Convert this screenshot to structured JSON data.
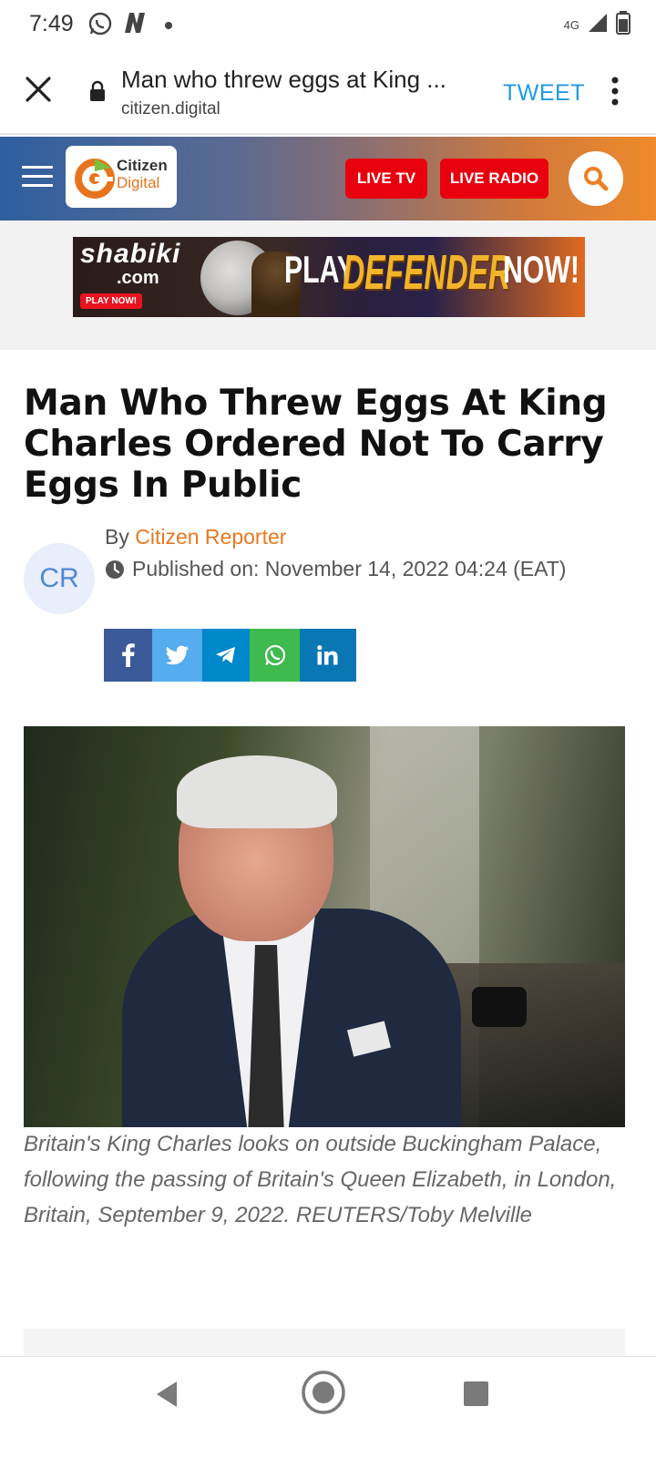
{
  "status_bar": {
    "time": "7:49",
    "network": "4G",
    "icons": [
      "whatsapp-icon",
      "n-app-icon",
      "dot-icon",
      "signal-icon",
      "battery-icon"
    ]
  },
  "browser": {
    "page_title": "Man who threw eggs at King ...",
    "domain": "citizen.digital",
    "action_label": "TWEET",
    "accent_color": "#1e9be0"
  },
  "site_header": {
    "logo_line1": "Citizen",
    "logo_line2": "Digital",
    "live_tv_label": "LIVE TV",
    "live_radio_label": "LIVE RADIO",
    "live_color": "#e8000f",
    "brand_color": "#f08a2a"
  },
  "ad": {
    "brand": "shabiki",
    "brand_suffix": ".com",
    "cta_small": "PLAY NOW!",
    "headline_play": "PLAY",
    "headline_game": "DEFENDER",
    "headline_now": "NOW!"
  },
  "article": {
    "title": "Man Who Threw Eggs At King Charles Ordered Not To Carry Eggs In Public",
    "avatar_initials": "CR",
    "by_prefix": "By",
    "author": "Citizen Reporter",
    "published": "Published on: November 14, 2022 04:24 (EAT)",
    "share_icons": [
      "facebook-icon",
      "twitter-icon",
      "telegram-icon",
      "whatsapp-icon",
      "linkedin-icon"
    ],
    "image_caption": "Britain's King Charles looks on outside Buckingham Palace, following the passing of Britain's Queen Elizabeth, in London, Britain, September 9, 2022. REUTERS/Toby Melville"
  },
  "nav_bar": {
    "icons": [
      "back-icon",
      "home-icon",
      "recents-icon"
    ]
  }
}
